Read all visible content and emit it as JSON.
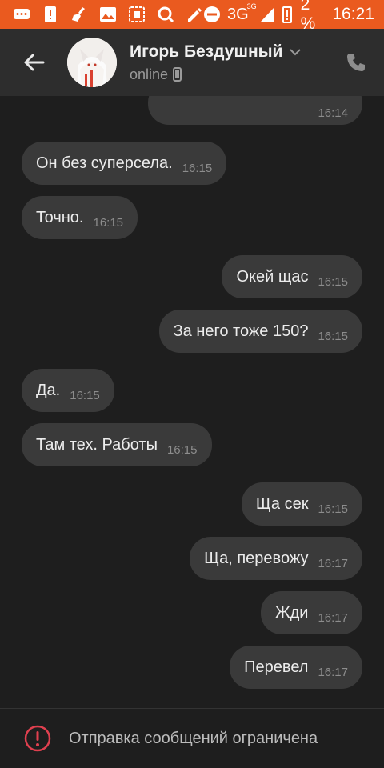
{
  "status_bar": {
    "network": "3G",
    "network_sup": "3G",
    "battery": "2 %",
    "time": "16:21"
  },
  "header": {
    "name": "Игорь Бездушный",
    "status": "online"
  },
  "messages": [
    {
      "dir": "out",
      "text": "",
      "time": "16:14"
    },
    {
      "dir": "in",
      "text": "Он без суперсела.",
      "time": "16:15"
    },
    {
      "dir": "in",
      "text": "Точно.",
      "time": "16:15"
    },
    {
      "dir": "out",
      "text": "Окей щас",
      "time": "16:15"
    },
    {
      "dir": "out",
      "text": "За него тоже 150?",
      "time": "16:15"
    },
    {
      "dir": "in",
      "text": "Да.",
      "time": "16:15"
    },
    {
      "dir": "in",
      "text": "Там тех. Работы",
      "time": "16:15"
    },
    {
      "dir": "out",
      "text": "Ща сек",
      "time": "16:15"
    },
    {
      "dir": "out",
      "text": "Ща, перевожу",
      "time": "16:17"
    },
    {
      "dir": "out",
      "text": "Жди",
      "time": "16:17"
    },
    {
      "dir": "out",
      "text": "Перевел",
      "time": "16:17"
    }
  ],
  "footer": {
    "notice": "Отправка сообщений ограничена"
  },
  "colors": {
    "status_bar": "#ea5a1f",
    "header": "#2d2d2d",
    "background": "#1e1e1e",
    "bubble": "#3a3a3a",
    "warning": "#e0404f"
  }
}
